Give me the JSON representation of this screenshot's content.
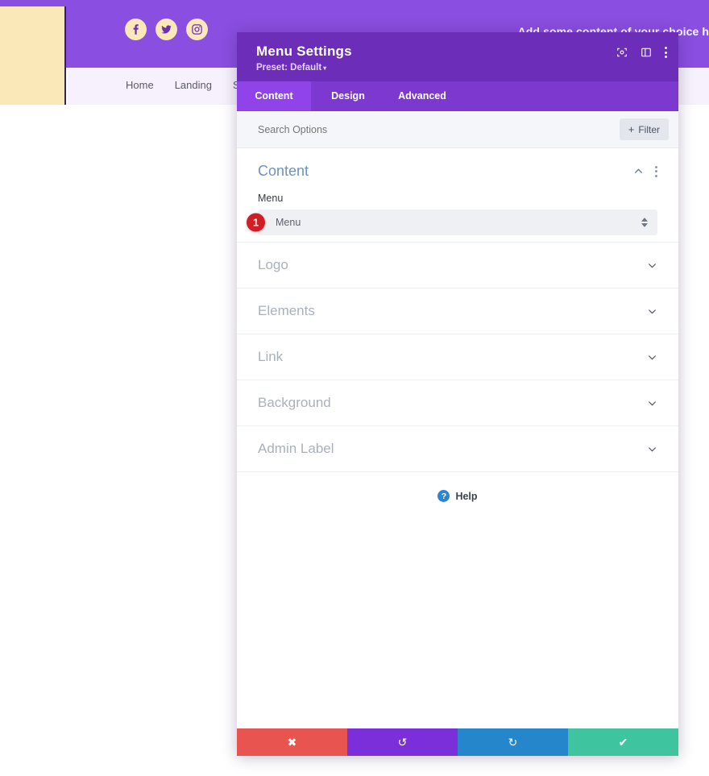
{
  "site": {
    "topbar_text": "Add some content of your choice h",
    "social_icons": [
      {
        "name": "facebook-icon",
        "label": "Facebook"
      },
      {
        "name": "twitter-icon",
        "label": "Twitter"
      },
      {
        "name": "instagram-icon",
        "label": "Instagram"
      }
    ],
    "nav_links": [
      "Home",
      "Landing",
      "Ser"
    ]
  },
  "modal": {
    "title": "Menu Settings",
    "preset": "Preset: Default",
    "preset_caret": "▾",
    "header_tools": [
      {
        "name": "focus-target-icon",
        "label": "Focus"
      },
      {
        "name": "layout-panel-icon",
        "label": "Layout"
      },
      {
        "name": "more-options-icon",
        "label": "More Options"
      }
    ],
    "tabs": [
      {
        "label": "Content",
        "active": true
      },
      {
        "label": "Design",
        "active": false
      },
      {
        "label": "Advanced",
        "active": false
      }
    ],
    "search": {
      "placeholder": "Search Options",
      "value": ""
    },
    "filter_button": {
      "label": "Filter",
      "plus": "+"
    },
    "content_section": {
      "title": "Content",
      "expanded": true,
      "field": {
        "label": "Menu",
        "value": "Menu",
        "options": [
          "Menu"
        ],
        "badge": "1"
      }
    },
    "collapsed_sections": [
      {
        "label": "Logo"
      },
      {
        "label": "Elements"
      },
      {
        "label": "Link"
      },
      {
        "label": "Background"
      },
      {
        "label": "Admin Label"
      }
    ],
    "help": {
      "label": "Help",
      "icon_glyph": "?"
    },
    "footer_buttons": [
      {
        "name": "cancel-button",
        "icon": "✖",
        "class": "cancel"
      },
      {
        "name": "undo-button",
        "icon": "↺",
        "class": "undo"
      },
      {
        "name": "redo-button",
        "icon": "↻",
        "class": "redo"
      },
      {
        "name": "save-button",
        "icon": "✔",
        "class": "save"
      }
    ]
  },
  "colors": {
    "modal_header": "#6c2eb9",
    "tab_bar": "#7d38cf",
    "tab_active": "#8f43e8",
    "site_purple": "#8a4ee0",
    "beige": "#fbe8b8",
    "badge_red": "#cf1f25",
    "help_blue": "#2b87d6",
    "cancel_red": "#e8544f",
    "undo_purple": "#7a2fdb",
    "redo_blue": "#2586cc",
    "save_green": "#3fc4a0",
    "section_title": "#6c93b8"
  }
}
